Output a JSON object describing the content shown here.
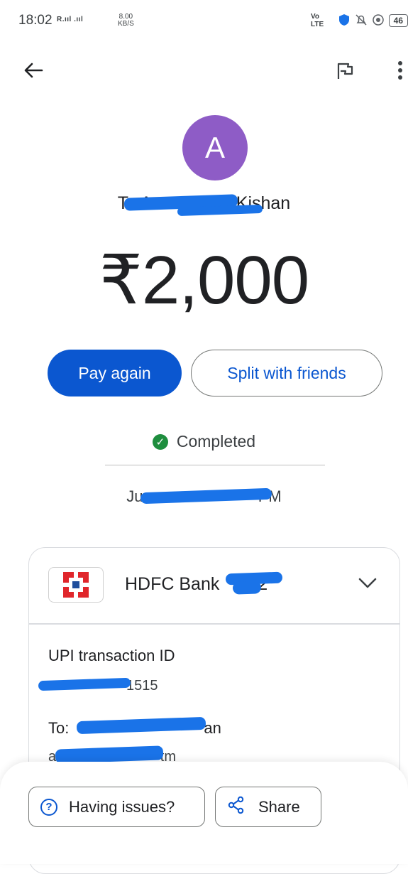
{
  "status_bar": {
    "time": "18:02",
    "signal": "R.ııl .ııl",
    "speed_value": "8.00",
    "speed_unit": "KB/S",
    "network": "Vo LTE",
    "battery": "46"
  },
  "header": {
    "back_icon": "arrow-left-icon",
    "flag_icon": "flag-icon",
    "menu_icon": "more-vert-icon"
  },
  "payment": {
    "avatar_letter": "A",
    "recipient_prefix": "To Ar",
    "recipient_suffix": "Kishan",
    "amount": "₹2,000",
    "pay_again": "Pay again",
    "split": "Split with friends",
    "status": "Completed",
    "datetime_prefix": "Jun",
    "datetime_suffix": "PM"
  },
  "details": {
    "bank_name": "HDFC Bank",
    "bank_suffix": "72",
    "upi_label": "UPI transaction ID",
    "upi_id_suffix": "1515",
    "to_prefix": "To:",
    "to_suffix": "an",
    "to_handle_prefix": "ar",
    "to_handle_suffix": "tm"
  },
  "footer": {
    "issues": "Having issues?",
    "share": "Share"
  },
  "colors": {
    "accent": "#0b57d0",
    "avatar": "#8e5cc6",
    "success": "#1e8e3e",
    "hdfc_red": "#e0262b",
    "hdfc_blue": "#1f4e9c"
  }
}
